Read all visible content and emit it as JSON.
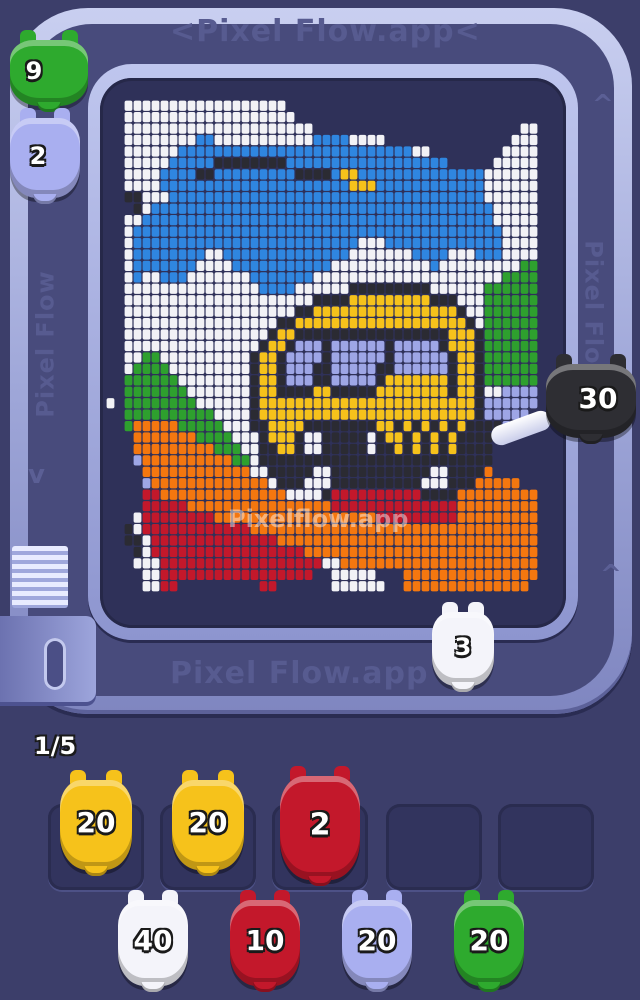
{
  "watermarks": {
    "top": "<Pixel Flow.app<",
    "bottom": "Pixel Flow.app",
    "left": "Pixel Flow",
    "right": "Pixel Flow",
    "center": "Pixelflow.app"
  },
  "level_counter": "1/5",
  "track_shooters": [
    {
      "id": "green",
      "value": "9",
      "color": "#2eaa2e"
    },
    {
      "id": "lavender",
      "value": "2",
      "color": "#a9aff0"
    },
    {
      "id": "black",
      "value": "30",
      "color": "#2e2e33"
    },
    {
      "id": "white",
      "value": "3",
      "color": "#f4f4fa"
    }
  ],
  "queue_slots": [
    {
      "value": "20",
      "color": "#f6c21b",
      "filled": true
    },
    {
      "value": "20",
      "color": "#f6c21b",
      "filled": true
    },
    {
      "value": "2",
      "color": "#c3182b",
      "filled": true
    },
    {
      "value": "",
      "color": "",
      "filled": false
    },
    {
      "value": "",
      "color": "",
      "filled": false
    }
  ],
  "reserve": [
    {
      "value": "40",
      "color": "#f4f4fa"
    },
    {
      "value": "10",
      "color": "#c3182b"
    },
    {
      "value": "20",
      "color": "#a9aff0"
    },
    {
      "value": "20",
      "color": "#2eaa2e"
    }
  ],
  "palette": {
    "W": "#f2f2f6",
    "B": "#2f86e0",
    "K": "#2b2b33",
    "Y": "#f6c21b",
    "G": "#2ea02e",
    "O": "#f4770f",
    "R": "#c3182b",
    "L": "#9ea6e6",
    "E": "#3b3d66"
  },
  "pixel_art_rows": [
    "..WWWWWWWWWWWWWWWWWW............................",
    "..WWWWWWWWWWWWWWWWWWW...........................",
    "..WWWWWWWWWWWWWWWWWWWWW.......................WW",
    "..WWWWWWWWBBWWWWWWWWWWWBBBBWWWW..............WWW",
    "..WWWWWWBBBBBBBBBBBBBBBBBBBBBBBBBBWW........WWWW",
    "..WWWWWBBBBBKKKKKKKKBBBBBBBBBBBBBBBBBB.....WWWWW",
    "..WWWWBBBBKKBBBBBBBBBKKKKBYYBBBBBBBBBBBBBBWWWWWW",
    "..WWWWBBBBBBBBBBBBBBBBBBBBBYYYBBBBBBBBBBBBWWWWWW",
    "..KKWWWBBBBBBBBBBBBBBBBBBBBBBBBBBBBBBBBBBBWWWWWW",
    "...KWBBBBBBBBBBBBBBBBBBBBBBBBBBBBBBBBBBBBBBWWWWW",
    "..WWBBBBBBBBBBBBBBBBBBBBBBBBBBBBBBBBBBBBBBBWWWWW",
    "..WBBBBBBBBBBBBBBBBBBBBBBBBBBBBBBBBBBBBBBBBBWWWW",
    "..WBBBBBBBBBBBBBBBBBBBBBBBBBWWWBBBBBBBBBBBBBWWWW",
    "..WBBBBBBBBWWBBBBBBBBBBBBBBWWWWWWWBBBBWWWBBBWWWW",
    "..WBBBBBBBWWWWBBBBBBBBBBBWWWWWWWWWWWBWWWWWWWWWGG",
    "..WBWWBBBWWWWWWWBBBBBBBWWWWWWWWWWWWWWWWWWWWWGGGG",
    "..WWWWWWWWWWWWWWWBBBBWWWWWWKKKKKKKKKWWWWWWGGGGGG",
    "..WWWWWWWWWWWWWWWWWWWWWKKKKYYYYYYYYYKKKWWWGGGGGG",
    "..WWWWWWWWWWWWWWWWWWWKKYYYYYYYYYYYYYYYYKWWGGGGGG",
    "..WWWWWWWWWWWWWWWWWKKYYYYYYYYYYYYYYYYYYYKWGGGGGG",
    "..WWWWWWWWWWWWWWWWKYYKKKKKKKKKKKKKKKKKYYYKGGGGGG",
    "..WWWWWWWWWWWWWWWKYYKLLLKLLLLLLKLLLLLKYYYKGGGGGG",
    "..WWGGWWWWWWWWWWKYYKLLLLKLLLLLLKLLLLLLKYYKGGGGGG",
    "..WGGGGWWWWWWWWWKYYKLLLKKLLLLLKKLLLLLLKYYKGGGGGG",
    "..GGGGGGWWWWWWWWKYYKLLLKKLLLLLKYYYYYYYKYYKGGGGGG",
    "..GGGGGGGWWWWWWWKYYKKKKYYKKKKKYYYYYYYYKYYKWWLLLL",
    "W.GGGGGGGGWWWWWWKYYYYYYYYYYYYYYYYYYYYYYYYKLLLLLL",
    "..GGGGGGGGGGWWWWKYYYYYYYYYYYYYYYYYYYYYYYYKLLLLL.",
    "..GOOOOOGGGGGWWWKKYYYYKKKKKKKKYYKYKYKYKYKKKKL...",
    "...OOOOOOOGGGGWWWKYYYKWWKKKKKWKYYKYKYKYKKKKK....",
    "...OOOOOOOOOGGGWWKKYYKWWKKKKKWKKYKYKYKYKKKK.....",
    "...LOOOOOOOOOOGGWKKKKKKKKKKKKKKKKKKKKKKKKKK.....",
    "....OOOOOOOOOOOOWWKKKKKWWKKKKKKKKKKKWWKKKKO.....",
    "....LOOOOOOOOOOOOOWKKKWWWKKKKKKKKKKWWWKKKOOOOO..",
    "....RROOOOOOOOOOOOOOWWWWKRRRRRRRRRRKKKKOOOOOOOOO",
    "....RRRRROOOOOOOOOOOOOOOORRRRRRRRRRRRRROOOOOOOOO",
    "...WRRRRRRRROOOOOOOOOOOOOOOOOORRRRRRRRROOOOOOOOO",
    "..KWRRRRRRRRRRRROOOOOOOOOOOOOOOOOOOOOOOOOOOOOOOO",
    "..KKWRRRRRRRRRRRRRROOOOOOOOOOOOOOOOOOOOOOOOOOOOO",
    "...KWRRRRRRRRRRRRRRRRROOOOOOOOOOOOOOOOOOOOOOOOOO",
    "...WWWRRRRRRRRRRRRRRRRRRWWOOOOOOOOOOOOOOOOOOOOOO",
    "....WWRRRRRRRRRRRRRRRRR..WWWWW...OOOOOOOOOOOOOOO",
    "....WWRR.........RR......WWWWWW..OOOOOOOOOOOOOO."
  ]
}
